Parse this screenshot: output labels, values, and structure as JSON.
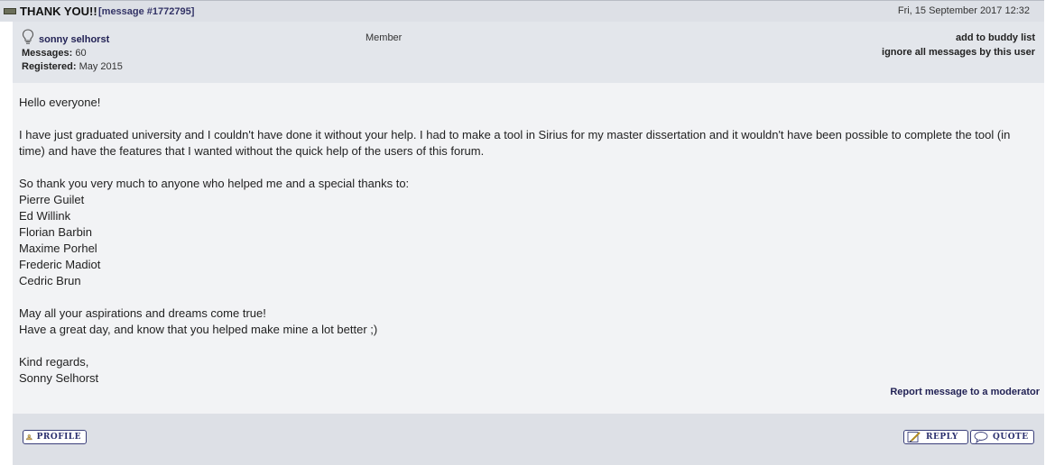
{
  "title_bar": {
    "title": "THANK YOU!!",
    "message_id": "[message #1772795]",
    "date": "Fri, 15 September 2017 12:32"
  },
  "author": {
    "name": "sonny selhorst",
    "messages_label": "Messages:",
    "messages_value": "60",
    "registered_label": "Registered:",
    "registered_value": "May 2015",
    "rank": "Member",
    "add_buddy": "add to buddy list",
    "ignore": "ignore all messages by this user"
  },
  "message": {
    "lines": [
      "Hello everyone!",
      "",
      "I have just graduated university and I couldn't have done it without your help. I had to make a tool in Sirius for my master dissertation and it wouldn't have been possible to complete the tool (in time) and have the features that I wanted without the quick help of the users of this forum.",
      "",
      "So thank you very much to anyone who helped me and a special thanks to:",
      "Pierre Guilet",
      "Ed Willink",
      "Florian Barbin",
      "Maxime Porhel",
      "Frederic Madiot",
      "Cedric Brun",
      "",
      "May all your aspirations and dreams come true!",
      "Have a great day, and know that you helped make mine a lot better ;)",
      "",
      "Kind regards,",
      "Sonny Selhorst"
    ],
    "report": "Report message to a moderator"
  },
  "footer": {
    "profile_label": "PROFILE",
    "reply_label": "REPLY",
    "quote_label": "QUOTE"
  },
  "icons": {
    "title": "post-icon",
    "author": "lightbulb-icon",
    "profile": "profile-person-icon",
    "reply": "reply-pencil-icon",
    "quote": "quote-bubble-icon"
  },
  "colors": {
    "header_bg": "#dde0e6",
    "author_bg": "#e3e6eb",
    "body_bg": "#f2f3f5",
    "link": "#222255",
    "button_border": "#3a3f7a"
  }
}
